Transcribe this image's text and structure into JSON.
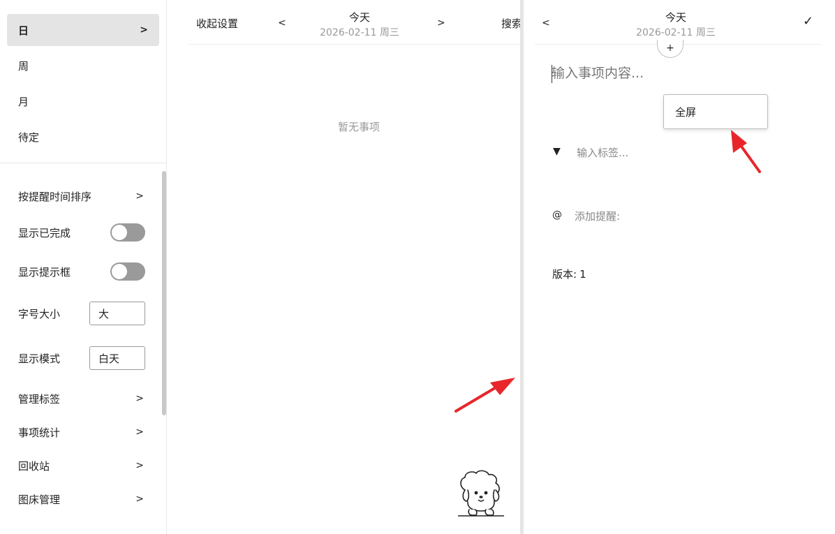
{
  "sidebar": {
    "views": [
      {
        "label": "日",
        "chevron": ">"
      },
      {
        "label": "周"
      },
      {
        "label": "月"
      },
      {
        "label": "待定"
      }
    ],
    "settings": {
      "sort": {
        "label": "按提醒时间排序",
        "chevron": ">"
      },
      "show_completed": {
        "label": "显示已完成",
        "on": false
      },
      "show_hint": {
        "label": "显示提示框",
        "on": false
      },
      "font_size": {
        "label": "字号大小",
        "value": "大"
      },
      "display_mode": {
        "label": "显示模式",
        "value": "白天"
      },
      "manage_tags": {
        "label": "管理标签",
        "chevron": ">"
      },
      "stats": {
        "label": "事项统计",
        "chevron": ">"
      },
      "recycle": {
        "label": "回收站",
        "chevron": ">"
      },
      "image_host": {
        "label": "图床管理",
        "chevron": ">"
      }
    }
  },
  "middle": {
    "collapse_label": "收起设置",
    "prev": "<",
    "next": ">",
    "date_title": "今天",
    "date_sub": "2026-02-11 周三",
    "search_label": "搜索",
    "empty_text": "暂无事项"
  },
  "editor": {
    "back": "<",
    "date_title": "今天",
    "date_sub": "2026-02-11 周三",
    "confirm": "✓",
    "add": "+",
    "content_placeholder": "输入事项内容...",
    "popup_label": "全屏",
    "tag_arrow": "▼",
    "tag_placeholder": "输入标签...",
    "at": "@",
    "reminder_placeholder": "添加提醒:",
    "version_label": "版本:",
    "version_value": "1"
  },
  "colors": {
    "active_bg": "#e4e4e4",
    "toggle_off": "#9a9a9a",
    "annotation_arrow": "#e8262a"
  }
}
